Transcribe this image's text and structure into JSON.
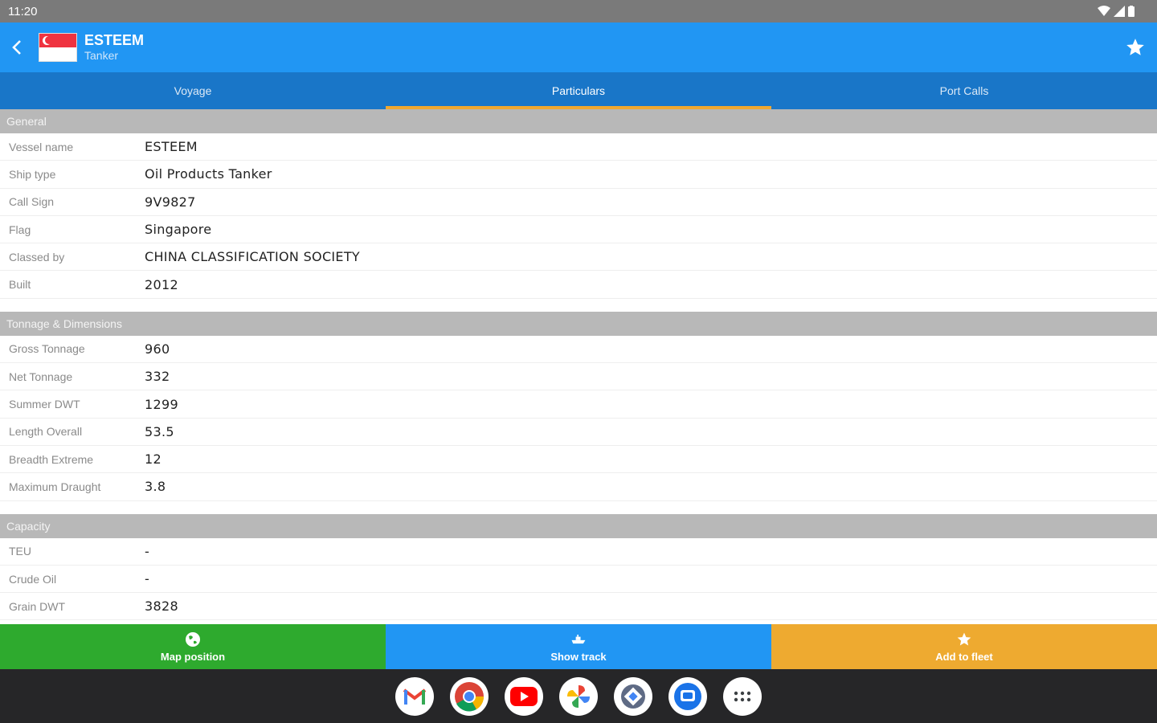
{
  "status": {
    "time": "11:20"
  },
  "appbar": {
    "title": "ESTEEM",
    "subtitle": "Tanker"
  },
  "tabs": [
    {
      "label": "Voyage",
      "active": false
    },
    {
      "label": "Particulars",
      "active": true
    },
    {
      "label": "Port Calls",
      "active": false
    }
  ],
  "sections": [
    {
      "title": "General",
      "rows": [
        {
          "label": "Vessel name",
          "value": "ESTEEM"
        },
        {
          "label": "Ship type",
          "value": "Oil Products Tanker"
        },
        {
          "label": "Call Sign",
          "value": "9V9827"
        },
        {
          "label": "Flag",
          "value": "Singapore"
        },
        {
          "label": "Classed by",
          "value": "CHINA CLASSIFICATION SOCIETY"
        },
        {
          "label": "Built",
          "value": "2012"
        }
      ]
    },
    {
      "title": "Tonnage & Dimensions",
      "rows": [
        {
          "label": "Gross Tonnage",
          "value": "960"
        },
        {
          "label": "Net Tonnage",
          "value": "332"
        },
        {
          "label": "Summer DWT",
          "value": "1299"
        },
        {
          "label": "Length Overall",
          "value": "53.5"
        },
        {
          "label": "Breadth Extreme",
          "value": "12"
        },
        {
          "label": "Maximum Draught",
          "value": "3.8"
        }
      ]
    },
    {
      "title": "Capacity",
      "rows": [
        {
          "label": "TEU",
          "value": "-"
        },
        {
          "label": "Crude Oil",
          "value": "-"
        },
        {
          "label": "Grain DWT",
          "value": "3828"
        }
      ]
    }
  ],
  "actions": {
    "map": "Map position",
    "track": "Show track",
    "fleet": "Add to fleet"
  },
  "colors": {
    "appbar": "#2196f3",
    "tabs": "#1976c8",
    "tab_indicator": "#f0a830",
    "map_button": "#2eaa2e",
    "track_button": "#2196f3",
    "fleet_button": "#eeaa30"
  },
  "dock": [
    "gmail-icon",
    "chrome-icon",
    "youtube-icon",
    "photos-icon",
    "maps-icon",
    "messages-icon",
    "apps-icon"
  ]
}
